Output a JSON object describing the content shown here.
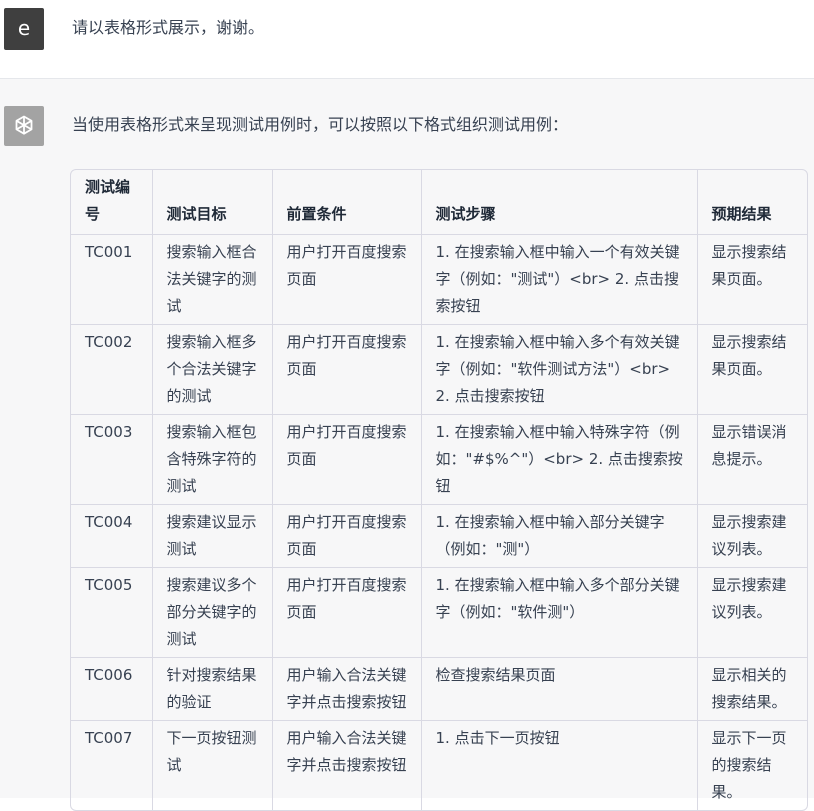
{
  "user": {
    "avatar_letter": "e",
    "message": "请以表格形式展示，谢谢。"
  },
  "assistant": {
    "intro": "当使用表格形式来呈现测试用例时，可以按照以下格式组织测试用例：",
    "table": {
      "headers": [
        "测试编号",
        "测试目标",
        "前置条件",
        "测试步骤",
        "预期结果"
      ],
      "rows": [
        [
          "TC001",
          "搜索输入框合法关键字的测试",
          "用户打开百度搜索页面",
          "1. 在搜索输入框中输入一个有效关键字（例如：\"测试\"）<br> 2. 点击搜索按钮",
          "显示搜索结果页面。"
        ],
        [
          "TC002",
          "搜索输入框多个合法关键字的测试",
          "用户打开百度搜索页面",
          "1. 在搜索输入框中输入多个有效关键字（例如：\"软件测试方法\"）<br> 2. 点击搜索按钮",
          "显示搜索结果页面。"
        ],
        [
          "TC003",
          "搜索输入框包含特殊字符的测试",
          "用户打开百度搜索页面",
          "1. 在搜索输入框中输入特殊字符（例如：\"#$%^\"）<br> 2. 点击搜索按钮",
          "显示错误消息提示。"
        ],
        [
          "TC004",
          "搜索建议显示测试",
          "用户打开百度搜索页面",
          "1. 在搜索输入框中输入部分关键字（例如：\"测\"）",
          "显示搜索建议列表。"
        ],
        [
          "TC005",
          "搜索建议多个部分关键字的测试",
          "用户打开百度搜索页面",
          "1. 在搜索输入框中输入多个部分关键字（例如：\"软件测\"）",
          "显示搜索建议列表。"
        ],
        [
          "TC006",
          "针对搜索结果的验证",
          "用户输入合法关键字并点击搜索按钮",
          "检查搜索结果页面",
          "显示相关的搜索结果。"
        ],
        [
          "TC007",
          "下一页按钮测试",
          "用户输入合法关键字并点击搜索按钮",
          "1. 点击下一页按钮",
          "显示下一页的搜索结果。"
        ]
      ]
    }
  },
  "colors": {
    "user_avatar_bg": "#3f3f3f",
    "bot_avatar_bg": "#a3a3a3",
    "assistant_bg": "#f7f7f8",
    "border": "#d9d9e3"
  },
  "icons": {
    "bot_avatar": "openai-logo-icon"
  }
}
